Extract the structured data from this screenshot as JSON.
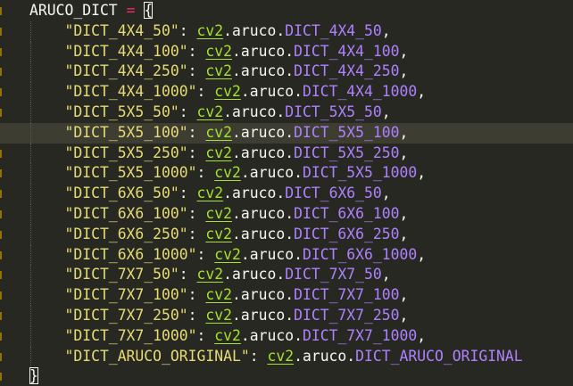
{
  "editor": {
    "var_name": "ARUCO_DICT",
    "assign_op": "=",
    "open_brace": "{",
    "close_brace": "}",
    "module": "cv2",
    "submodule": "aruco",
    "entries": [
      {
        "key": "\"DICT_4X4_50\"",
        "attr": "DICT_4X4_50",
        "comma": ","
      },
      {
        "key": "\"DICT_4X4_100\"",
        "attr": "DICT_4X4_100",
        "comma": ","
      },
      {
        "key": "\"DICT_4X4_250\"",
        "attr": "DICT_4X4_250",
        "comma": ","
      },
      {
        "key": "\"DICT_4X4_1000\"",
        "attr": "DICT_4X4_1000",
        "comma": ","
      },
      {
        "key": "\"DICT_5X5_50\"",
        "attr": "DICT_5X5_50",
        "comma": ","
      },
      {
        "key": "\"DICT_5X5_100\"",
        "attr": "DICT_5X5_100",
        "comma": ","
      },
      {
        "key": "\"DICT_5X5_250\"",
        "attr": "DICT_5X5_250",
        "comma": ","
      },
      {
        "key": "\"DICT_5X5_1000\"",
        "attr": "DICT_5X5_1000",
        "comma": ","
      },
      {
        "key": "\"DICT_6X6_50\"",
        "attr": "DICT_6X6_50",
        "comma": ","
      },
      {
        "key": "\"DICT_6X6_100\"",
        "attr": "DICT_6X6_100",
        "comma": ","
      },
      {
        "key": "\"DICT_6X6_250\"",
        "attr": "DICT_6X6_250",
        "comma": ","
      },
      {
        "key": "\"DICT_6X6_1000\"",
        "attr": "DICT_6X6_1000",
        "comma": ","
      },
      {
        "key": "\"DICT_7X7_50\"",
        "attr": "DICT_7X7_50",
        "comma": ","
      },
      {
        "key": "\"DICT_7X7_100\"",
        "attr": "DICT_7X7_100",
        "comma": ","
      },
      {
        "key": "\"DICT_7X7_250\"",
        "attr": "DICT_7X7_250",
        "comma": ","
      },
      {
        "key": "\"DICT_7X7_1000\"",
        "attr": "DICT_7X7_1000",
        "comma": ","
      },
      {
        "key": "\"DICT_ARUCO_ORIGINAL\"",
        "attr": "DICT_ARUCO_ORIGINAL",
        "comma": ""
      }
    ],
    "active_line_index": 5
  },
  "colors": {
    "background": "#272822",
    "active_line": "#3e3d32",
    "string": "#e6db74",
    "operator": "#f92672",
    "module": "#a6e22e",
    "constant": "#ae81ff",
    "text": "#f8f8f2"
  }
}
